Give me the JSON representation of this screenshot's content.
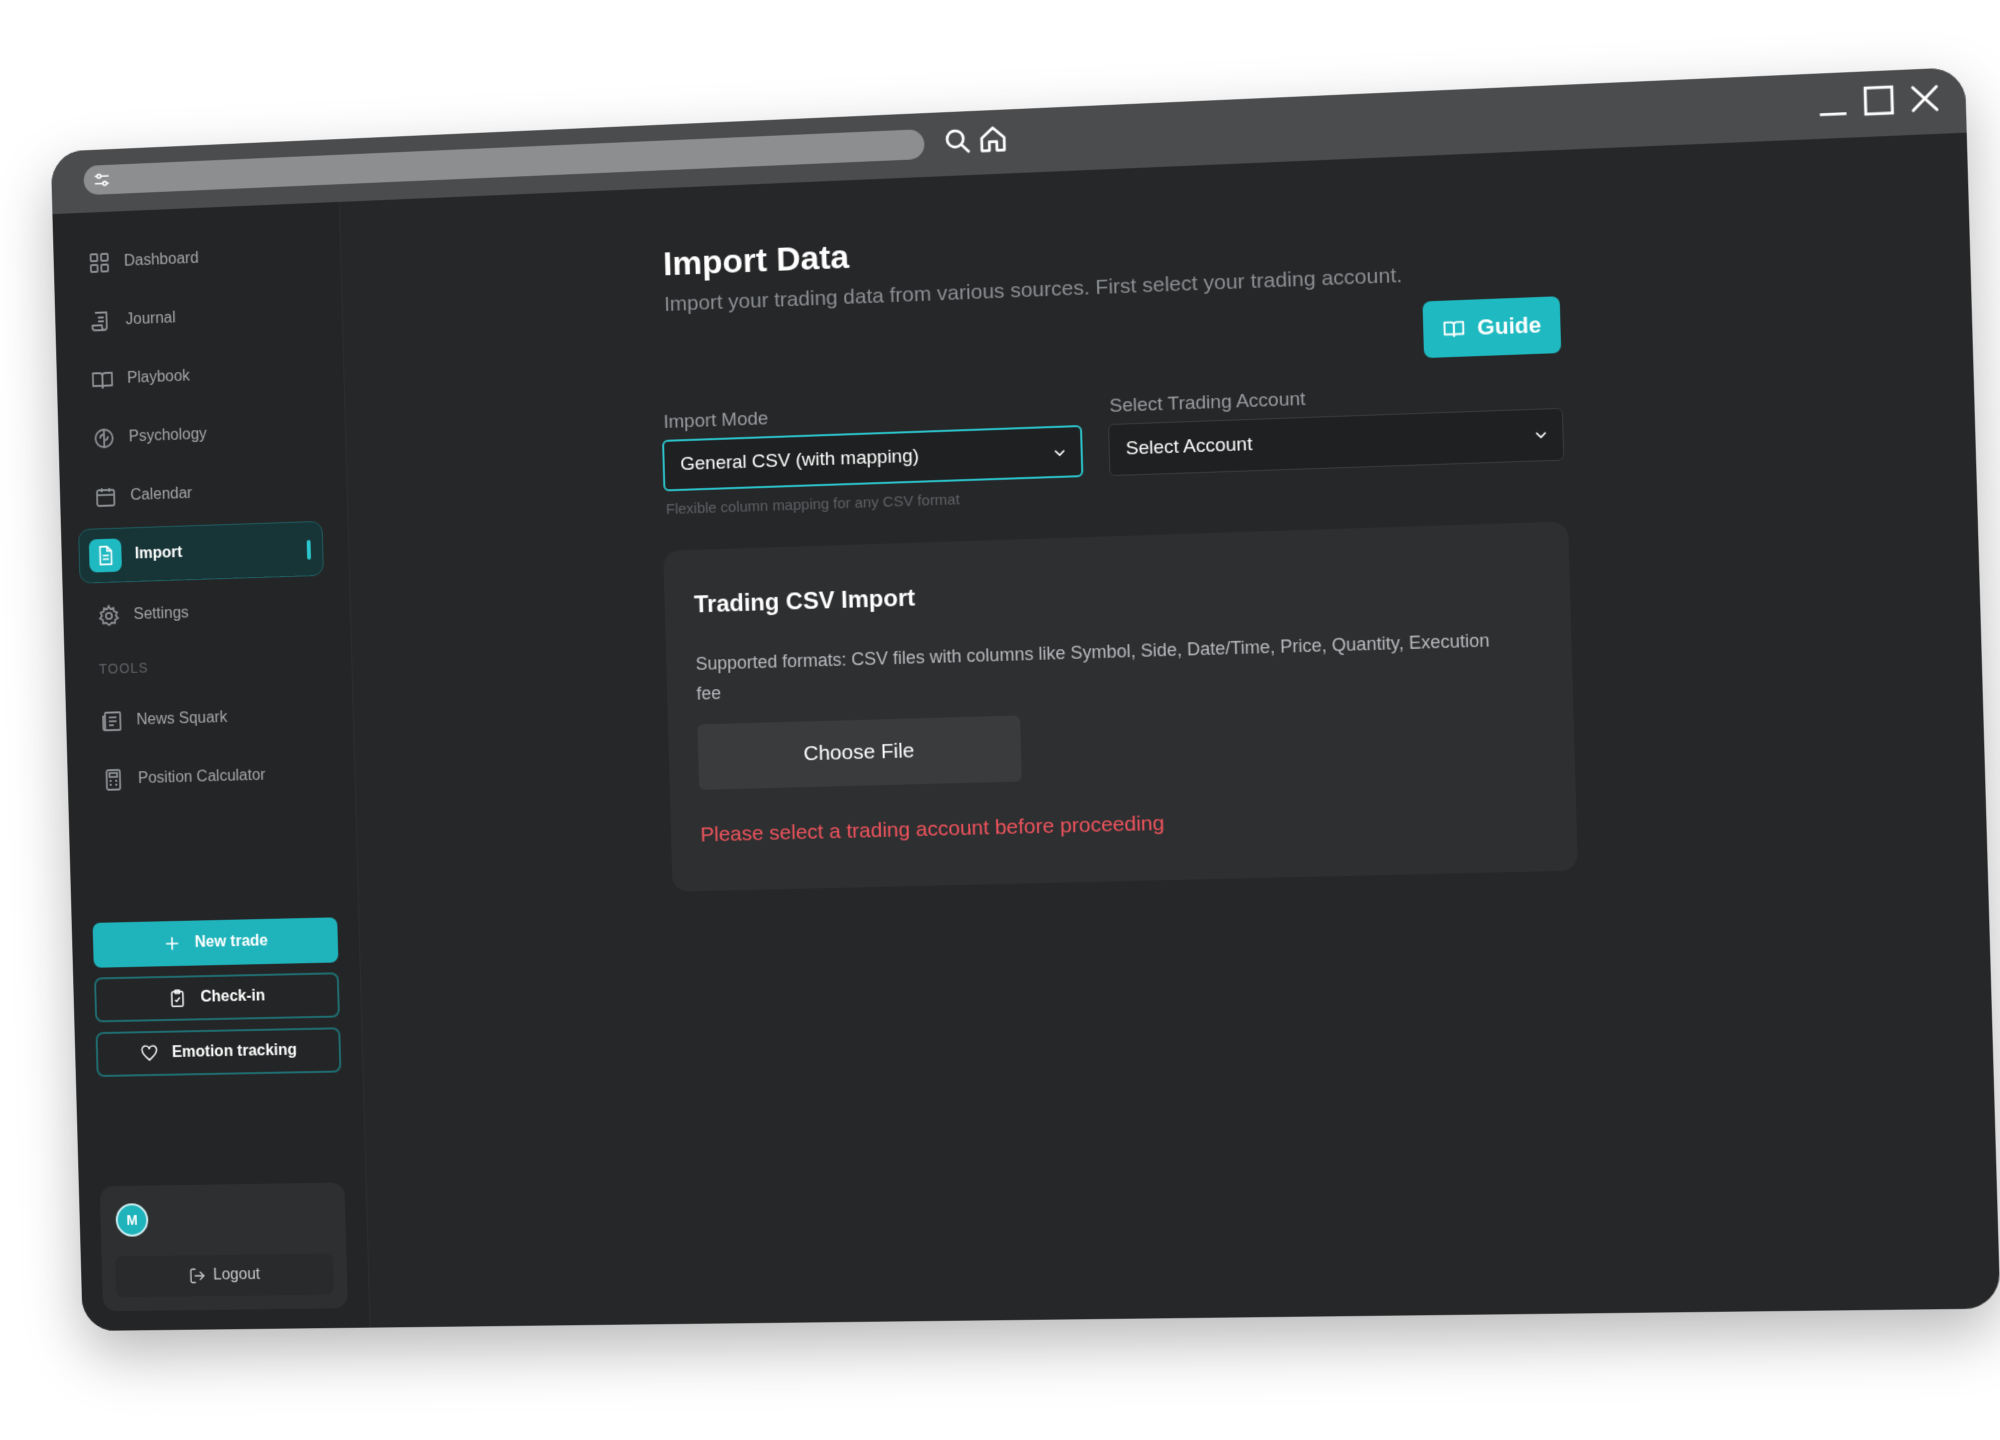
{
  "nav": {
    "items": [
      {
        "label": "Dashboard",
        "icon": "grid-icon"
      },
      {
        "label": "Journal",
        "icon": "scroll-icon"
      },
      {
        "label": "Playbook",
        "icon": "book-icon"
      },
      {
        "label": "Psychology",
        "icon": "brain-icon"
      },
      {
        "label": "Calendar",
        "icon": "calendar-icon"
      },
      {
        "label": "Import",
        "icon": "file-icon",
        "active": true
      },
      {
        "label": "Settings",
        "icon": "gear-icon"
      }
    ],
    "tools_label": "TOOLS",
    "tools": [
      {
        "label": "News Squark",
        "icon": "newspaper-icon"
      },
      {
        "label": "Position Calculator",
        "icon": "calculator-icon"
      }
    ]
  },
  "actions": {
    "new_trade": "New trade",
    "check_in": "Check-in",
    "emotion_tracking": "Emotion tracking"
  },
  "user": {
    "avatar_initial": "M",
    "logout_label": "Logout"
  },
  "main": {
    "title": "Import Data",
    "subtitle": "Import your trading data from various sources. First select your trading account.",
    "guide_button": "Guide",
    "import_mode_label": "Import Mode",
    "import_mode_value": "General CSV (with mapping)",
    "import_mode_hint": "Flexible column mapping for any CSV format",
    "account_label": "Select Trading Account",
    "account_value": "Select Account",
    "card": {
      "title": "Trading CSV Import",
      "description": "Supported formats: CSV files with columns like Symbol, Side, Date/Time, Price, Quantity, Execution fee",
      "choose_file": "Choose File",
      "error": "Please select a trading account before proceeding"
    }
  },
  "colors": {
    "accent": "#1fb9c1",
    "error": "#f0545d",
    "background": "#262728",
    "titlebar": "#4b4c4e"
  }
}
